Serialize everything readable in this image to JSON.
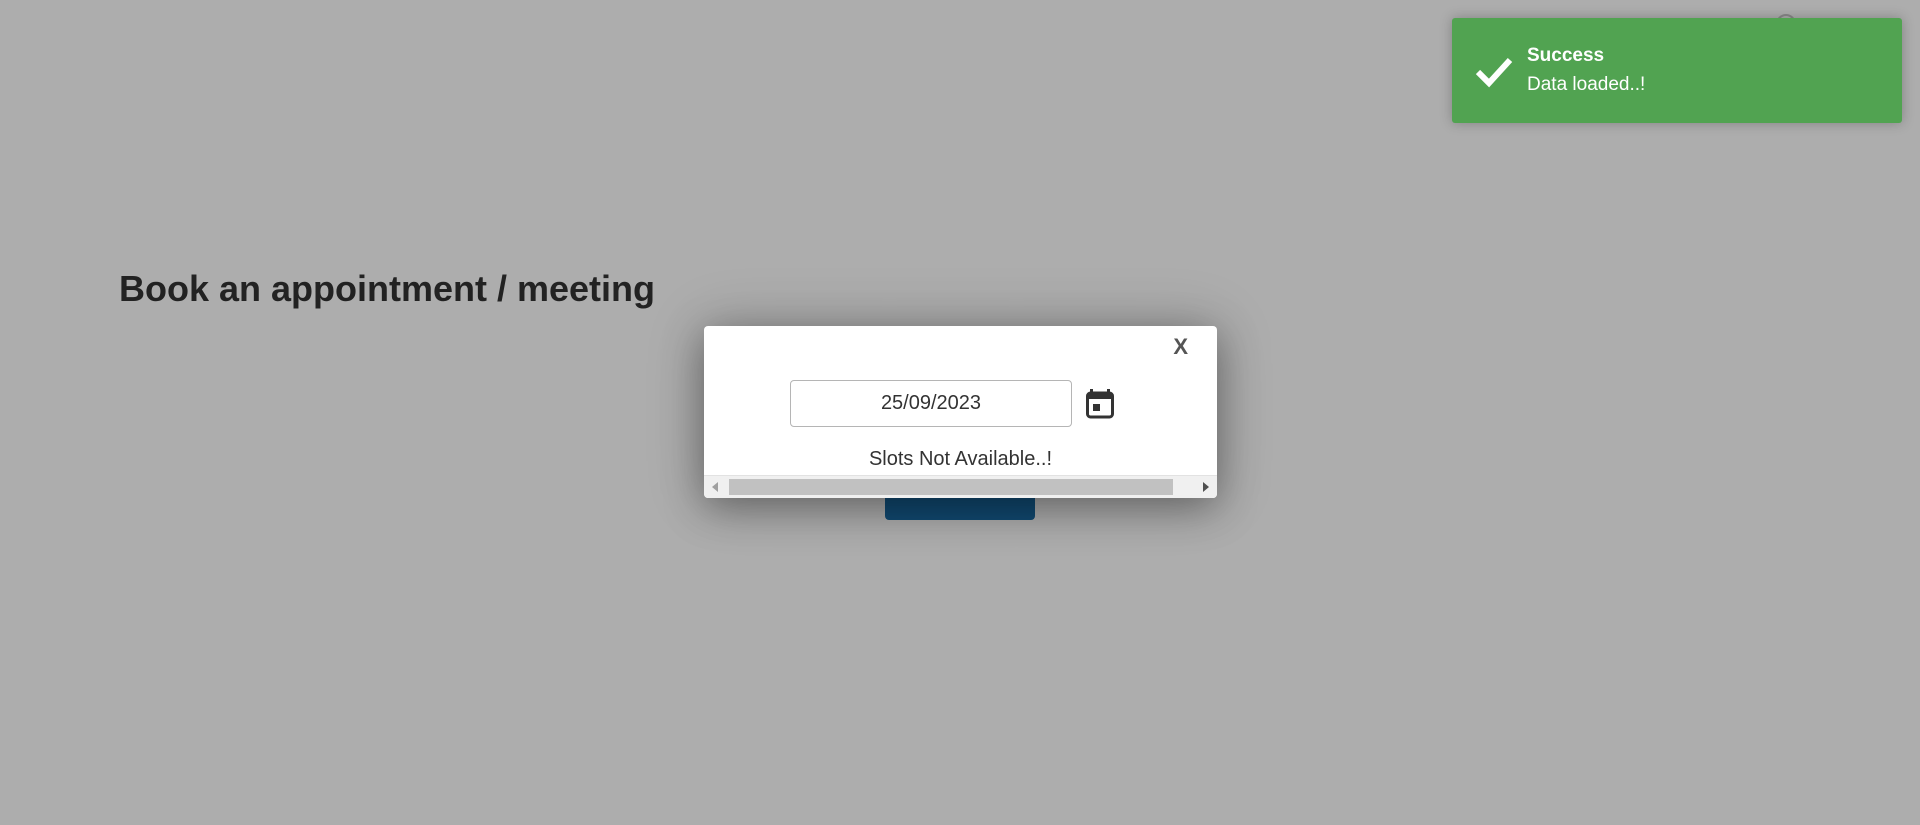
{
  "page": {
    "title": "Book an appointment / meeting"
  },
  "modal": {
    "close_label": "X",
    "date_value": "25/09/2023",
    "slots_message": "Slots Not Available..!"
  },
  "toast": {
    "title": "Success",
    "message": "Data loaded..!",
    "icon": "checkmark-icon",
    "color": "#51a351"
  },
  "colors": {
    "overlay": "rgba(0,0,0,0.32)",
    "text": "#333333"
  }
}
